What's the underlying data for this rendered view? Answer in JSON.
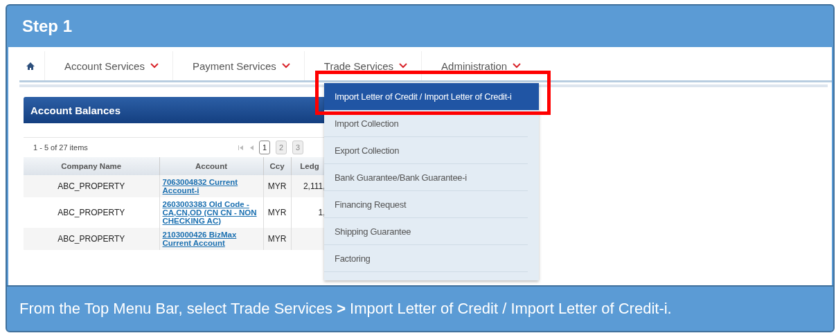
{
  "step": {
    "title": "Step 1"
  },
  "nav": {
    "items": [
      {
        "label": "Account Services"
      },
      {
        "label": "Payment Services"
      },
      {
        "label": "Trade Services"
      },
      {
        "label": "Administration"
      }
    ]
  },
  "panel": {
    "title": "Account Balances",
    "summary": "1 - 5 of 27 items",
    "pages": [
      {
        "label": "1",
        "selected": true
      },
      {
        "label": "2",
        "selected": false
      },
      {
        "label": "3",
        "selected": false
      }
    ]
  },
  "table": {
    "columns": [
      "Company Name",
      "Account",
      "Ccy",
      "Ledg"
    ],
    "rows": [
      {
        "company": "ABC_PROPERTY",
        "account": "7063004832 Current Account-i",
        "ccy": "MYR",
        "ledger": "2,111,"
      },
      {
        "company": "ABC_PROPERTY",
        "account": "2603003383 Old Code - CA,CN,OD (CN CN - NON CHECKING AC)",
        "ccy": "MYR",
        "ledger": "1,"
      },
      {
        "company": "ABC_PROPERTY",
        "account": "2103000426 BizMax Current Account",
        "ccy": "MYR",
        "ledger": ""
      }
    ]
  },
  "dropdown": {
    "items": [
      {
        "label": "Import Letter of Credit / Import Letter of Credit-i",
        "selected": true
      },
      {
        "label": "Import Collection",
        "selected": false
      },
      {
        "label": "Export Collection",
        "selected": false
      },
      {
        "label": "Bank Guarantee/Bank Guarantee-i",
        "selected": false
      },
      {
        "label": "Financing Request",
        "selected": false
      },
      {
        "label": "Shipping Guarantee",
        "selected": false
      },
      {
        "label": "Factoring",
        "selected": false
      }
    ]
  },
  "caption": "From the Top Menu Bar, select Trade Services **>** Import Letter of Credit / Import Letter of Credit-i."
}
